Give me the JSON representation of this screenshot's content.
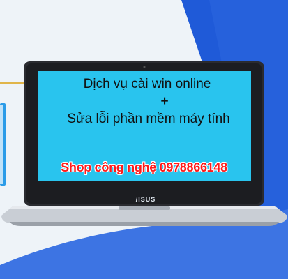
{
  "screen": {
    "line1": "Dịch vụ cài win online",
    "plus": "+",
    "line2": "Sửa lỗi phần mềm máy tính"
  },
  "overlay": {
    "shop_text": "Shop công nghệ 0978866148"
  },
  "laptop": {
    "brand": "/ISUS"
  },
  "colors": {
    "screen_bg": "#29c4ee",
    "accent_blue": "#1f5ad8",
    "shop_text": "#ff1a1a",
    "laptop_body": "#2a2b30"
  }
}
